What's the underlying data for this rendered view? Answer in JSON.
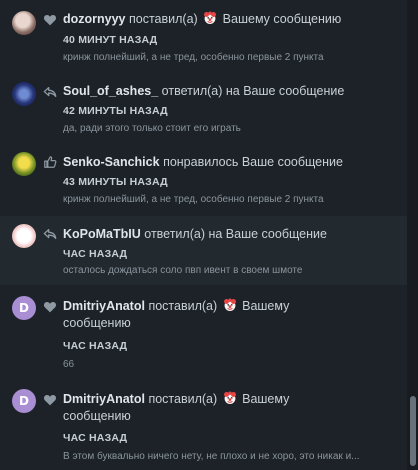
{
  "notifications": [
    {
      "user": "dozornyyy",
      "action_pre": "поставил(а)",
      "action_post": "Вашему сообщению",
      "time": "40 МИНУТ НАЗАД",
      "snippet": "кринж полнейший, а не тред, особенно первые 2 пункта",
      "icon": "heart-icon",
      "emoji": "clown-emoji"
    },
    {
      "user": "Soul_of_ashes_",
      "action": "ответил(а) на Ваше сообщение",
      "time": "42 МИНУТЫ НАЗАД",
      "snippet": "да, ради этого только стоит его играть",
      "icon": "reply-icon"
    },
    {
      "user": "Senko-Sanchick",
      "action": "понравилось Ваше сообщение",
      "time": "43 МИНУТЫ НАЗАД",
      "snippet": "кринж полнейший, а не тред, особенно первые 2 пункта",
      "icon": "thumbs-up-icon"
    },
    {
      "user": "KoPoMaTbIU",
      "action": "ответил(а) на Ваше сообщение",
      "time": "ЧАС НАЗАД",
      "snippet": "осталось дождаться соло пвп ивент в своем шмоте",
      "icon": "reply-icon"
    },
    {
      "user": "DmitriyAnatol",
      "avatar_letter": "D",
      "action_pre": "поставил(а)",
      "action_post": "Вашему сообщению",
      "time": "ЧАС НАЗАД",
      "snippet": "66",
      "icon": "heart-icon",
      "emoji": "clown-emoji"
    },
    {
      "user": "DmitriyAnatol",
      "avatar_letter": "D",
      "action_pre": "поставил(а)",
      "action_post": "Вашему сообщению",
      "time": "ЧАС НАЗАД",
      "snippet": "В этом буквально ничего нету, не плохо и не хоро, это никак и...",
      "icon": "heart-icon",
      "emoji": "clown-emoji"
    }
  ],
  "colors": {
    "background": "#1c2227",
    "highlight": "#22292f",
    "icon": "#8e99a3",
    "avatar_d": "#a98ed4"
  }
}
